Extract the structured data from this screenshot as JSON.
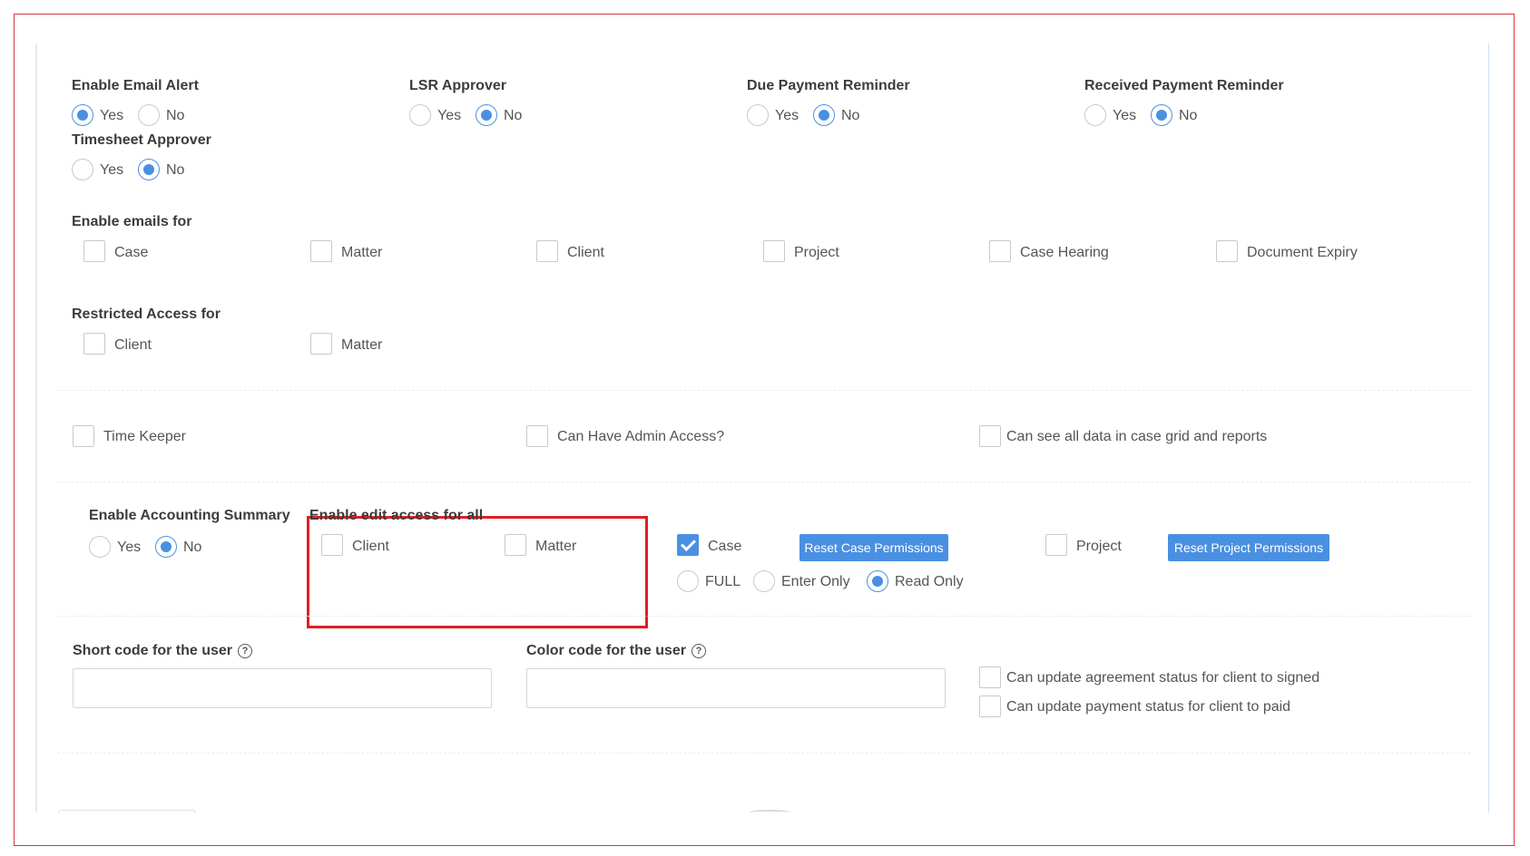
{
  "email_alert": {
    "label": "Enable Email Alert",
    "yes": "Yes",
    "no": "No",
    "selected": "Yes"
  },
  "lsr_approver": {
    "label": "LSR Approver",
    "yes": "Yes",
    "no": "No",
    "selected": "No"
  },
  "due_payment_reminder": {
    "label": "Due Payment Reminder",
    "yes": "Yes",
    "no": "No",
    "selected": "No"
  },
  "received_payment_reminder": {
    "label": "Received Payment Reminder",
    "yes": "Yes",
    "no": "No",
    "selected": "No"
  },
  "timesheet_approver": {
    "label": "Timesheet Approver",
    "yes": "Yes",
    "no": "No",
    "selected": "No"
  },
  "enable_emails_for": {
    "label": "Enable emails for",
    "items": [
      "Case",
      "Matter",
      "Client",
      "Project",
      "Case Hearing",
      "Document Expiry"
    ]
  },
  "restricted_access_for": {
    "label": "Restricted Access for",
    "items": [
      "Client",
      "Matter"
    ]
  },
  "flags": {
    "time_keeper": "Time Keeper",
    "admin_access": "Can Have Admin Access?",
    "see_all_data": "Can see all data in case grid and reports"
  },
  "accounting_summary": {
    "label": "Enable Accounting Summary",
    "yes": "Yes",
    "no": "No",
    "selected": "No"
  },
  "edit_access_all": {
    "label": "Enable edit access for all",
    "client": "Client",
    "matter": "Matter"
  },
  "case_permissions": {
    "label": "Case",
    "checked": true,
    "reset_button": "Reset Case Permissions",
    "modes": [
      "FULL",
      "Enter Only",
      "Read Only"
    ],
    "selected_mode": "Read Only"
  },
  "project_permissions": {
    "label": "Project",
    "checked": false,
    "reset_button": "Reset Project Permissions"
  },
  "short_code": {
    "label": "Short code for the user",
    "value": "",
    "help": "?"
  },
  "color_code": {
    "label": "Color code for the user",
    "value": "",
    "help": "?"
  },
  "agreement_status": "Can update agreement status for client to signed",
  "payment_status": "Can update payment status for client to paid",
  "colors": {
    "accent": "#4a90e2",
    "highlight": "#e01f26"
  }
}
